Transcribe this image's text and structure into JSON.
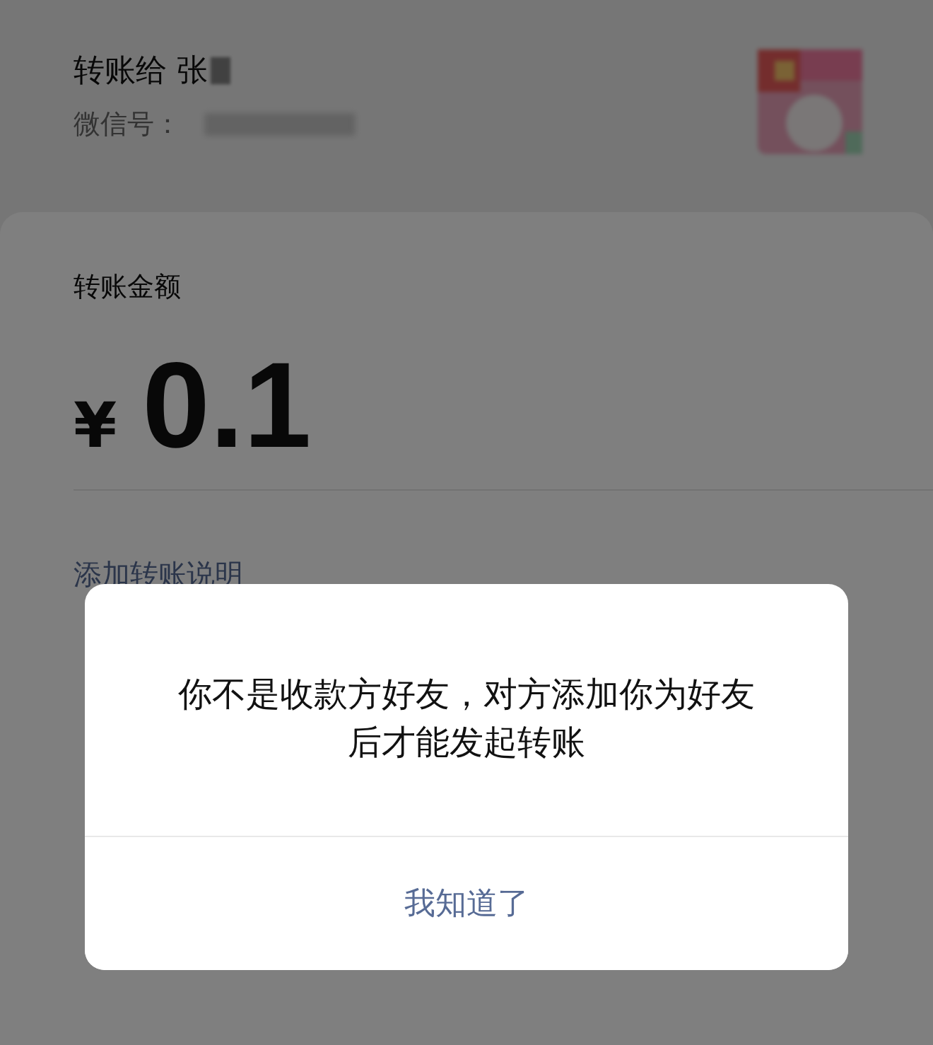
{
  "recipient": {
    "title": "转账给 张",
    "wechat_id_label": "微信号："
  },
  "transfer": {
    "amount_label": "转账金额",
    "currency": "¥",
    "amount": "0.1",
    "note_link": "添加转账说明"
  },
  "dialog": {
    "message": "你不是收款方好友，对方添加你为好友后才能发起转账",
    "button": "我知道了"
  }
}
